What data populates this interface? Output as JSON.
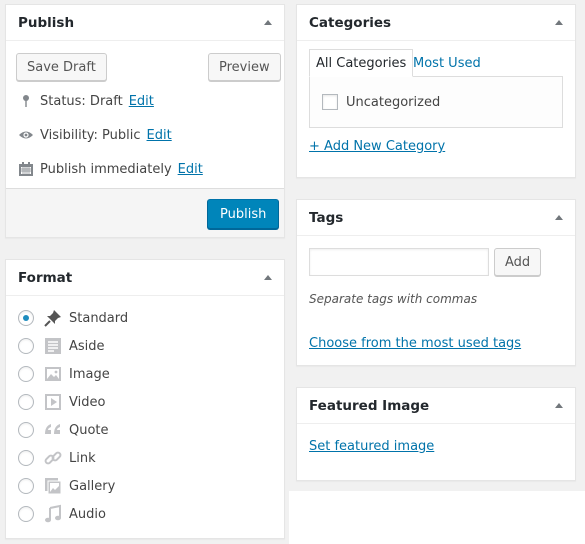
{
  "publish": {
    "title": "Publish",
    "save_draft": "Save Draft",
    "preview": "Preview",
    "status_label": "Status: Draft",
    "visibility_label": "Visibility: Public",
    "schedule_label": "Publish immediately",
    "edit": "Edit",
    "publish_button": "Publish"
  },
  "format": {
    "title": "Format",
    "options": [
      "Standard",
      "Aside",
      "Image",
      "Video",
      "Quote",
      "Link",
      "Gallery",
      "Audio"
    ],
    "selected": "Standard"
  },
  "categories": {
    "title": "Categories",
    "tabs": [
      "All Categories",
      "Most Used"
    ],
    "items": [
      "Uncategorized"
    ],
    "add_new": "+ Add New Category"
  },
  "tags": {
    "title": "Tags",
    "add_button": "Add",
    "hint": "Separate tags with commas",
    "choose_link": "Choose from the most used tags"
  },
  "featured_image": {
    "title": "Featured Image",
    "set_link": "Set featured image"
  },
  "colors": {
    "primary": "#0085ba",
    "link": "#0073aa",
    "background": "#f1f1f1"
  }
}
